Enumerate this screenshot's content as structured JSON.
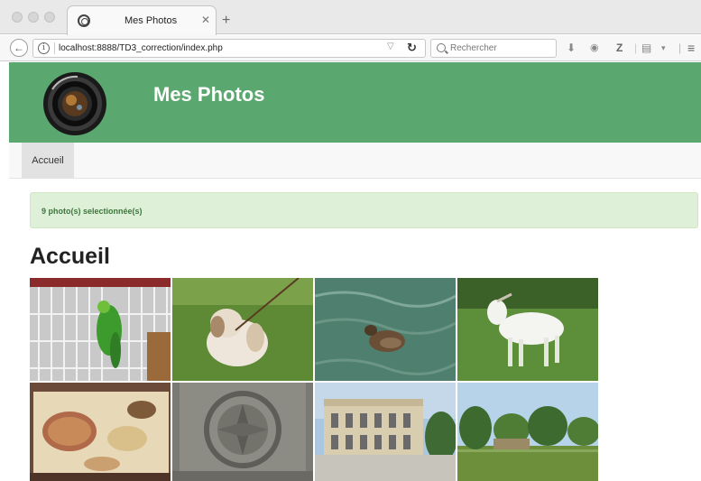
{
  "browser": {
    "tab_title": "Mes Photos",
    "url": "localhost:8888/TD3_correction/index.php",
    "search_placeholder": "Rechercher"
  },
  "header": {
    "site_title": "Mes Photos",
    "background": "#5aa86f"
  },
  "menu": {
    "items": [
      {
        "label": "Accueil"
      }
    ]
  },
  "alert": {
    "text": "9 photo(s) selectionnée(s)",
    "background": "#dff0d8",
    "text_color": "#3c763d"
  },
  "main": {
    "heading": "Accueil"
  },
  "icons": {
    "browser_back": "back-arrow-icon",
    "site_info": "info-icon",
    "reload": "reload-icon",
    "search": "search-icon",
    "download": "download-icon",
    "addon": "addon-icon",
    "zotero": "zotero-icon",
    "reader": "reader-icon",
    "menu": "hamburger-menu-icon"
  },
  "gallery": {
    "photos": [
      {
        "subject": "parrot-in-cage"
      },
      {
        "subject": "dog-on-grass"
      },
      {
        "subject": "duck-in-water"
      },
      {
        "subject": "white-goat"
      },
      {
        "subject": "plate-of-food"
      },
      {
        "subject": "carved-stone-ornament"
      },
      {
        "subject": "chateau-building"
      },
      {
        "subject": "park-landscape"
      }
    ]
  }
}
